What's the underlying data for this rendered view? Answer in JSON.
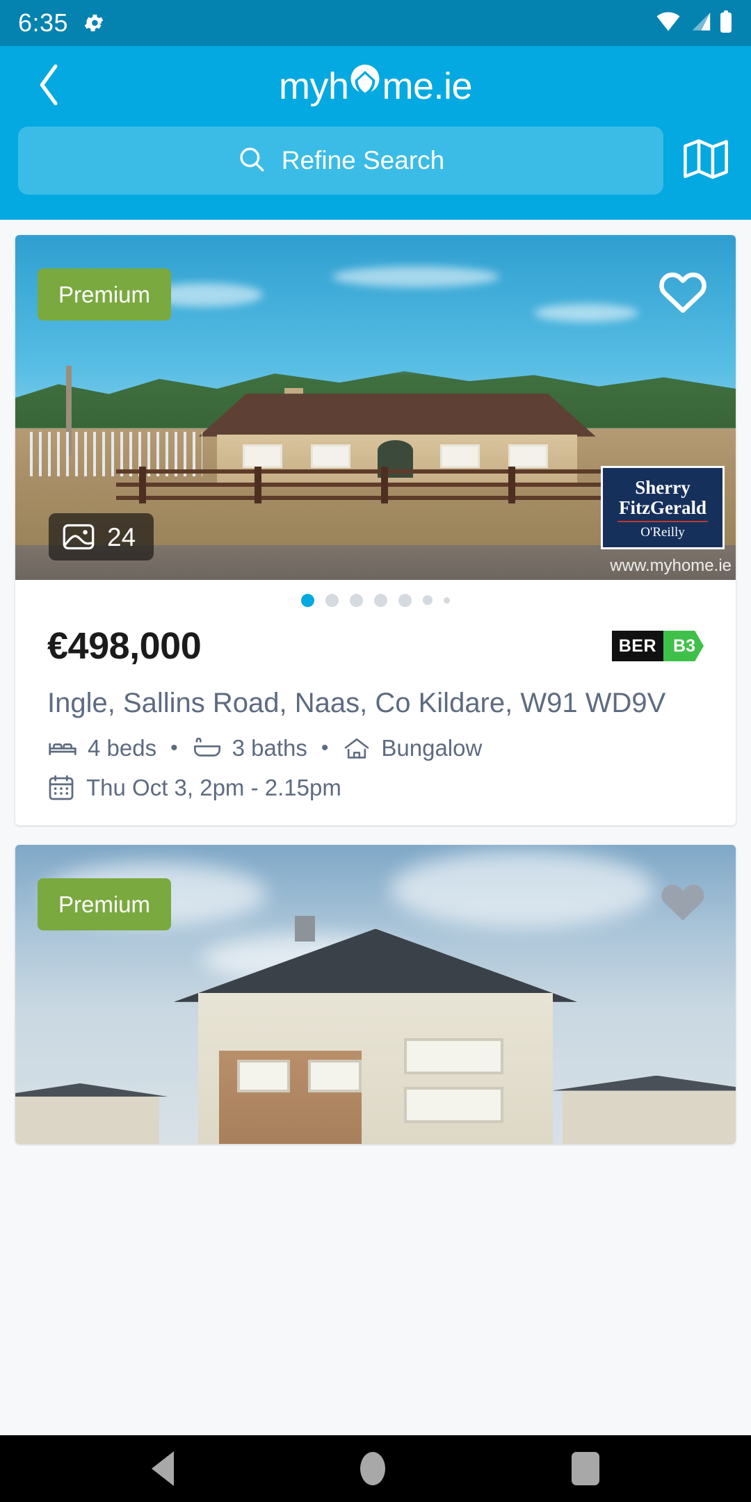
{
  "statusbar": {
    "time": "6:35",
    "icons": [
      "settings-gear-icon",
      "wifi-icon",
      "cell-signal-icon",
      "battery-icon"
    ]
  },
  "header": {
    "back_icon": "chevron-left-icon",
    "logo_part1": "myh",
    "logo_part2": "me.ie",
    "logo_icon": "house-pin-icon",
    "search": {
      "icon": "search-icon",
      "label": "Refine Search"
    },
    "map_icon": "map-folded-icon",
    "brand_color": "#03a9e0",
    "statusbar_color": "#0483b0"
  },
  "listings": [
    {
      "badge": "Premium",
      "badge_color": "#7aa93f",
      "favourite_icon": "heart-outline-icon",
      "favourite_filled": false,
      "photo_icon": "image-icon",
      "photo_count": "24",
      "agent": {
        "line1": "Sherry",
        "line2": "FitzGerald",
        "line3": "O'Reilly"
      },
      "watermark": "www.myhome.ie",
      "carousel": {
        "total": 7,
        "active": 0
      },
      "price": "€498,000",
      "ber": {
        "label": "BER",
        "rating": "B3",
        "color": "#3fc04a"
      },
      "address": "Ingle, Sallins Road, Naas, Co Kildare, W91 WD9V",
      "beds": "4 beds",
      "beds_icon": "bed-icon",
      "baths": "3 baths",
      "baths_icon": "bath-icon",
      "type": "Bungalow",
      "type_icon": "house-icon",
      "separator": "•",
      "viewing_icon": "calendar-icon",
      "viewing": "Thu Oct 3, 2pm - 2.15pm"
    },
    {
      "badge": "Premium",
      "badge_color": "#7aa93f",
      "favourite_icon": "heart-filled-icon",
      "favourite_filled": true
    }
  ],
  "navbar": {
    "back_icon": "nav-back-triangle-icon",
    "home_icon": "nav-home-circle-icon",
    "recents_icon": "nav-recents-square-icon"
  }
}
